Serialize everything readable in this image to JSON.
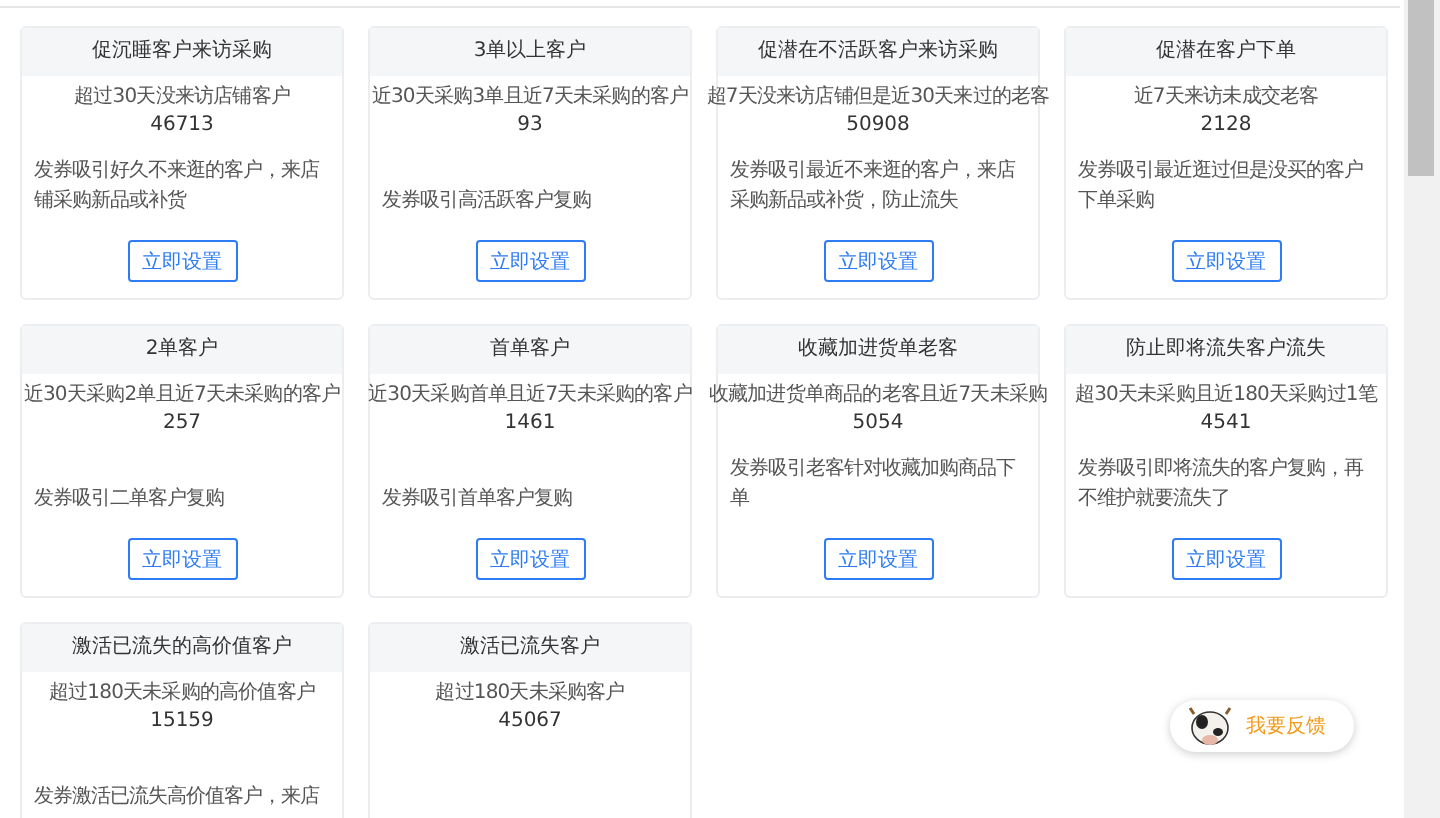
{
  "cards": [
    {
      "title": "促沉睡客户来访采购",
      "condition": "超过30天没来访店铺客户",
      "count": "46713",
      "description": "发券吸引好久不来逛的客户，来店铺采购新品或补货",
      "button": "立即设置"
    },
    {
      "title": "3单以上客户",
      "condition": "近30天采购3单且近7天未采购的客户",
      "count": "93",
      "description": "发券吸引高活跃客户复购",
      "button": "立即设置"
    },
    {
      "title": "促潜在不活跃客户来访采购",
      "condition": "超7天没来访店铺但是近30天来过的老客",
      "count": "50908",
      "description": "发券吸引最近不来逛的客户，来店采购新品或补货，防止流失",
      "button": "立即设置"
    },
    {
      "title": "促潜在客户下单",
      "condition": "近7天来访未成交老客",
      "count": "2128",
      "description": "发券吸引最近逛过但是没买的客户下单采购",
      "button": "立即设置"
    },
    {
      "title": "2单客户",
      "condition": "近30天采购2单且近7天未采购的客户",
      "count": "257",
      "description": "发券吸引二单客户复购",
      "button": "立即设置"
    },
    {
      "title": "首单客户",
      "condition": "近30天采购首单且近7天未采购的客户",
      "count": "1461",
      "description": "发券吸引首单客户复购",
      "button": "立即设置"
    },
    {
      "title": "收藏加进货单老客",
      "condition": "收藏加进货单商品的老客且近7天未采购",
      "count": "5054",
      "description": "发券吸引老客针对收藏加购商品下单",
      "button": "立即设置"
    },
    {
      "title": "防止即将流失客户流失",
      "condition": "超30天未采购且近180天采购过1笔",
      "count": "4541",
      "description": "发券吸引即将流失的客户复购，再不维护就要流失了",
      "button": "立即设置"
    },
    {
      "title": "激活已流失的高价值客户",
      "condition": "超过180天未采购的高价值客户",
      "count": "15159",
      "description": "发券激活已流失高价值客户，来店"
    },
    {
      "title": "激活已流失客户",
      "condition": "超过180天未采购客户",
      "count": "45067"
    }
  ],
  "feedback": {
    "label": "我要反馈"
  }
}
